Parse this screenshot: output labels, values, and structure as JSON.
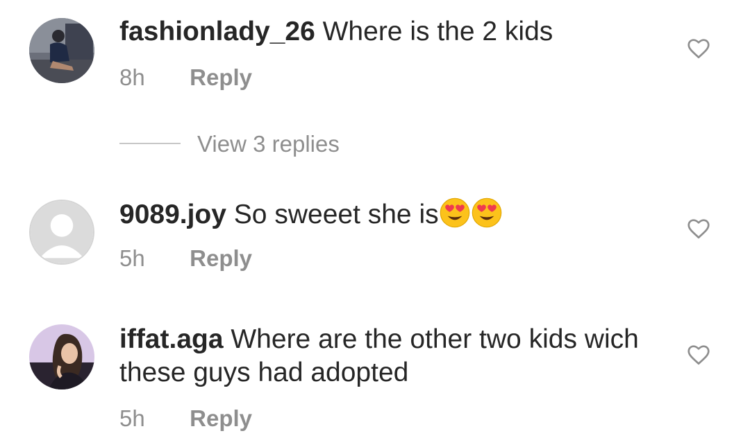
{
  "comments": [
    {
      "username": "fashionlady_26",
      "text": "Where is the 2 kids",
      "time": "8h",
      "reply_label": "Reply",
      "avatar": "photo-avatar-woman-seated"
    },
    {
      "username": "9089.joy",
      "text": "So sweeet she is",
      "emojis": [
        "heart-eyes-emoji",
        "heart-eyes-emoji"
      ],
      "time": "5h",
      "reply_label": "Reply",
      "avatar": "default-avatar"
    },
    {
      "username": "iffat.aga",
      "text": "Where are the other two kids wich these guys had adopted",
      "time": "5h",
      "reply_label": "Reply",
      "avatar": "photo-avatar-woman-portrait"
    }
  ],
  "view_replies_label": "View 3 replies",
  "icons": {
    "like": "heart-outline-icon"
  },
  "colors": {
    "text": "#262626",
    "secondary": "#8e8e8e",
    "divider": "#c7c7c7"
  }
}
